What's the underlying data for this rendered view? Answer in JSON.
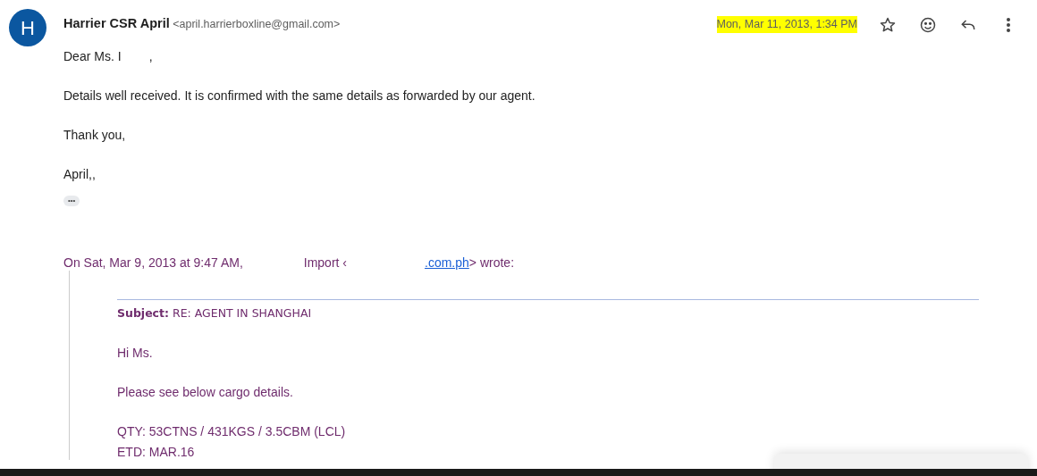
{
  "message": {
    "avatar_letter": "H",
    "sender_name": "Harrier CSR April",
    "sender_email": "<april.harrierboxline@gmail.com>",
    "date": "Mon, Mar 11, 2013, 1:34 PM",
    "date_highlighted": true,
    "starred": false
  },
  "body": [
    "Dear Ms. I        ,",
    "Details well received. It is confirmed with the same details as forwarded by our agent.",
    "Thank you,",
    "April,,"
  ],
  "trimmed_content": "•••",
  "quote_header": {
    "date_text": "On Sat, Mar 9, 2013 at 9:47 AM,",
    "sender_text": "Import ‹",
    "link": ".com.ph",
    "after_text": "> wrote:"
  },
  "quoted": {
    "subject": "**Subject:** RE: AGENT IN SHANGHAI",
    "greeting": "Hi Ms.",
    "lines": [
      "Please see below cargo details."
    ],
    "details": [
      "QTY: 53CTNS / 431KGS / 3.5CBM (LCL)",
      "ETD: MAR.16"
    ]
  }
}
